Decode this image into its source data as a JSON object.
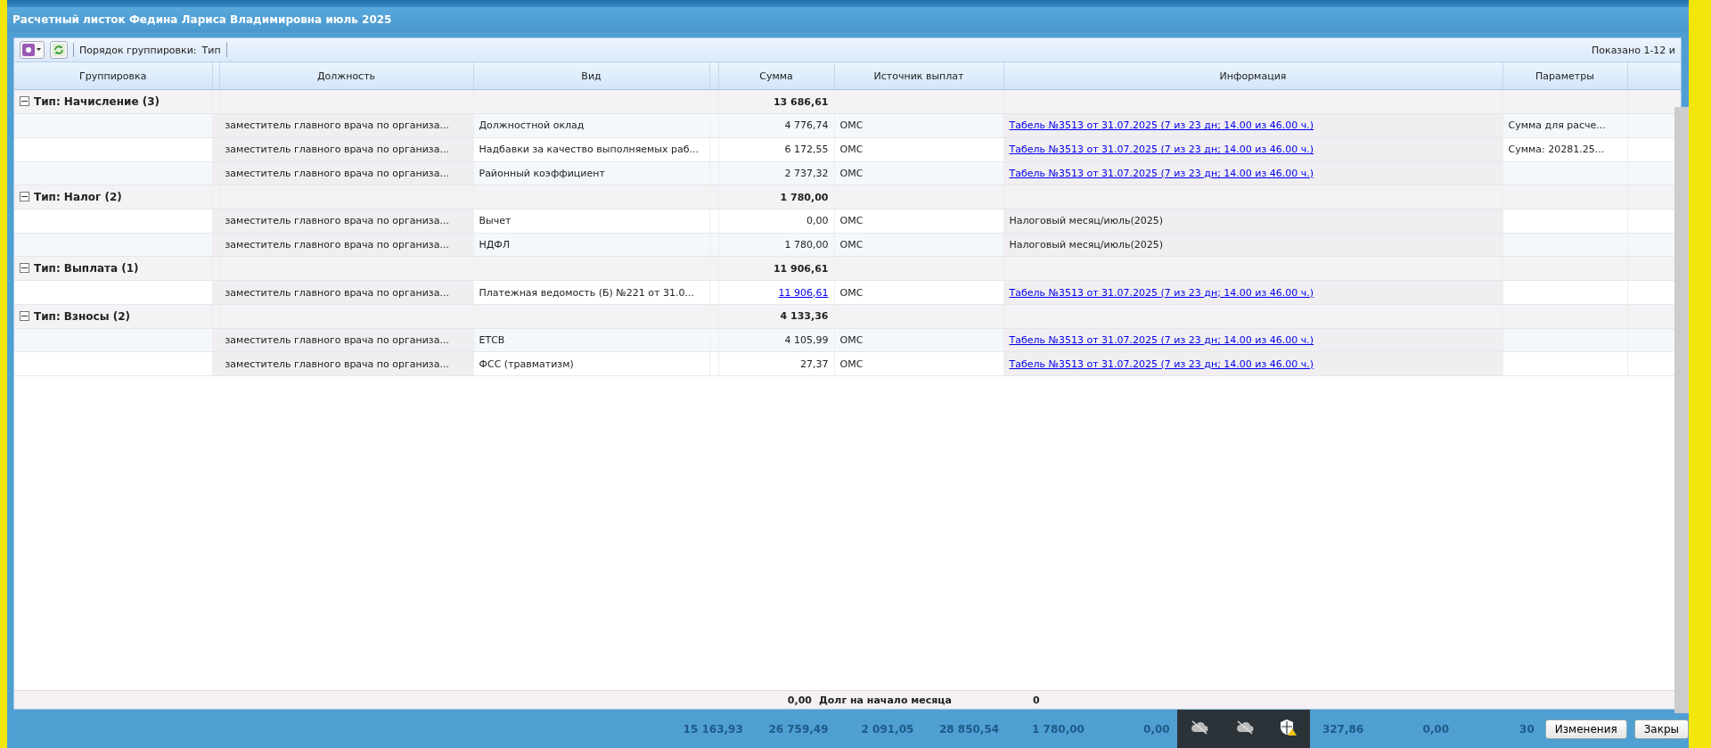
{
  "window": {
    "title": "Расчетный листок Федина Лариса Владимировна июль 2025"
  },
  "toolbar": {
    "grouping_label": "Порядок группировки:",
    "grouping_value": "Тип",
    "paging": "Показано 1-12 и"
  },
  "table": {
    "columns": [
      "Группировка",
      "Должность",
      "Вид",
      "Сумма",
      "Источник выплат",
      "Информация",
      "Параметры"
    ],
    "groups": [
      {
        "title": "Тип: Начисление (3)",
        "expanded": true,
        "total": "13 686,61",
        "rows": [
          {
            "position": "заместитель главного врача по организа...",
            "kind": "Должностной оклад",
            "amount": "4 776,74",
            "amount_link": false,
            "source": "ОМС",
            "info": "Табель №3513 от 31.07.2025 (7 из 23 дн; 14.00 из 46.00 ч.)",
            "info_link": true,
            "params": "Сумма для расче..."
          },
          {
            "position": "заместитель главного врача по организа...",
            "kind": "Надбавки за качество выполняемых раб...",
            "amount": "6 172,55",
            "amount_link": false,
            "source": "ОМС",
            "info": "Табель №3513 от 31.07.2025 (7 из 23 дн; 14.00 из 46.00 ч.)",
            "info_link": true,
            "params": "Сумма: 20281.25..."
          },
          {
            "position": "заместитель главного врача по организа...",
            "kind": "Районный коэффициент",
            "amount": "2 737,32",
            "amount_link": false,
            "source": "ОМС",
            "info": "Табель №3513 от 31.07.2025 (7 из 23 дн; 14.00 из 46.00 ч.)",
            "info_link": true
          }
        ]
      },
      {
        "title": "Тип: Налог (2)",
        "expanded": true,
        "total": "1 780,00",
        "rows": [
          {
            "position": "заместитель главного врача по организа...",
            "kind": "Вычет",
            "amount": "0,00",
            "amount_link": false,
            "source": "ОМС",
            "info": "Налоговый месяц/июль(2025)",
            "info_link": false
          },
          {
            "position": "заместитель главного врача по организа...",
            "kind": "НДФЛ",
            "amount": "1 780,00",
            "amount_link": false,
            "source": "ОМС",
            "info": "Налоговый месяц/июль(2025)",
            "info_link": false
          }
        ]
      },
      {
        "title": "Тип: Выплата (1)",
        "expanded": true,
        "total": "11 906,61",
        "rows": [
          {
            "position": "заместитель главного врача по организа...",
            "kind": "Платежная ведомость (Б) №221 от 31.0...",
            "amount": "11 906,61",
            "amount_link": true,
            "source": "ОМС",
            "info": "Табель №3513 от 31.07.2025 (7 из 23 дн; 14.00 из 46.00 ч.)",
            "info_link": true
          }
        ]
      },
      {
        "title": "Тип: Взносы (2)",
        "expanded": true,
        "total": "4 133,36",
        "rows": [
          {
            "position": "заместитель главного врача по организа...",
            "kind": "ЕТСВ",
            "amount": "4 105,99",
            "amount_link": false,
            "source": "ОМС",
            "info": "Табель №3513 от 31.07.2025 (7 из 23 дн; 14.00 из 46.00 ч.)",
            "info_link": true
          },
          {
            "position": "заместитель главного врача по организа...",
            "kind": "ФСС (травматизм)",
            "amount": "27,37",
            "amount_link": false,
            "source": "ОМС",
            "info": "Табель №3513 от 31.07.2025 (7 из 23 дн; 14.00 из 46.00 ч.)",
            "info_link": true
          }
        ]
      }
    ]
  },
  "footer": {
    "amount": "0,00",
    "label": "Долг на начало месяца",
    "value": "0"
  },
  "bottom_bar": {
    "totals": [
      "15 163,93",
      "26 759,49",
      "2 091,05",
      "28 850,54",
      "1 780,00",
      "0,00",
      "327,86",
      "0,00",
      "30"
    ],
    "buttons": [
      "Изменения",
      "Закры"
    ]
  }
}
